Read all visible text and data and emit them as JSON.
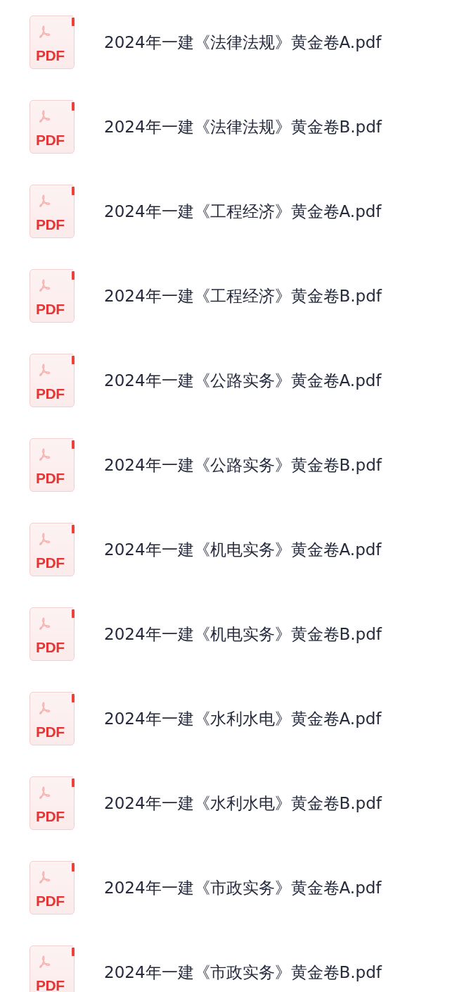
{
  "files": [
    {
      "name": "2024年一建《法律法规》黄金卷A.pdf",
      "badge": "PDF"
    },
    {
      "name": "2024年一建《法律法规》黄金卷B.pdf",
      "badge": "PDF"
    },
    {
      "name": "2024年一建《工程经济》黄金卷A.pdf",
      "badge": "PDF"
    },
    {
      "name": "2024年一建《工程经济》黄金卷B.pdf",
      "badge": "PDF"
    },
    {
      "name": "2024年一建《公路实务》黄金卷A.pdf",
      "badge": "PDF"
    },
    {
      "name": "2024年一建《公路实务》黄金卷B.pdf",
      "badge": "PDF"
    },
    {
      "name": "2024年一建《机电实务》黄金卷A.pdf",
      "badge": "PDF"
    },
    {
      "name": "2024年一建《机电实务》黄金卷B.pdf",
      "badge": "PDF"
    },
    {
      "name": "2024年一建《水利水电》黄金卷A.pdf",
      "badge": "PDF"
    },
    {
      "name": "2024年一建《水利水电》黄金卷B.pdf",
      "badge": "PDF"
    },
    {
      "name": "2024年一建《市政实务》黄金卷A.pdf",
      "badge": "PDF"
    },
    {
      "name": "2024年一建《市政实务》黄金卷B.pdf",
      "badge": "PDF"
    }
  ]
}
